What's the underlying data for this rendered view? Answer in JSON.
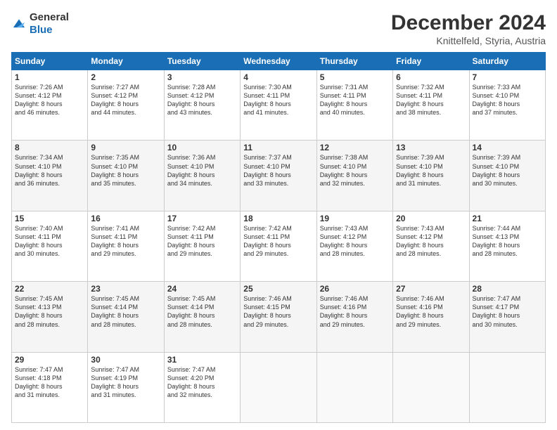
{
  "header": {
    "logo_general": "General",
    "logo_blue": "Blue",
    "month": "December 2024",
    "location": "Knittelfeld, Styria, Austria"
  },
  "weekdays": [
    "Sunday",
    "Monday",
    "Tuesday",
    "Wednesday",
    "Thursday",
    "Friday",
    "Saturday"
  ],
  "weeks": [
    [
      {
        "day": "1",
        "info": "Sunrise: 7:26 AM\nSunset: 4:12 PM\nDaylight: 8 hours\nand 46 minutes."
      },
      {
        "day": "2",
        "info": "Sunrise: 7:27 AM\nSunset: 4:12 PM\nDaylight: 8 hours\nand 44 minutes."
      },
      {
        "day": "3",
        "info": "Sunrise: 7:28 AM\nSunset: 4:12 PM\nDaylight: 8 hours\nand 43 minutes."
      },
      {
        "day": "4",
        "info": "Sunrise: 7:30 AM\nSunset: 4:11 PM\nDaylight: 8 hours\nand 41 minutes."
      },
      {
        "day": "5",
        "info": "Sunrise: 7:31 AM\nSunset: 4:11 PM\nDaylight: 8 hours\nand 40 minutes."
      },
      {
        "day": "6",
        "info": "Sunrise: 7:32 AM\nSunset: 4:11 PM\nDaylight: 8 hours\nand 38 minutes."
      },
      {
        "day": "7",
        "info": "Sunrise: 7:33 AM\nSunset: 4:10 PM\nDaylight: 8 hours\nand 37 minutes."
      }
    ],
    [
      {
        "day": "8",
        "info": "Sunrise: 7:34 AM\nSunset: 4:10 PM\nDaylight: 8 hours\nand 36 minutes."
      },
      {
        "day": "9",
        "info": "Sunrise: 7:35 AM\nSunset: 4:10 PM\nDaylight: 8 hours\nand 35 minutes."
      },
      {
        "day": "10",
        "info": "Sunrise: 7:36 AM\nSunset: 4:10 PM\nDaylight: 8 hours\nand 34 minutes."
      },
      {
        "day": "11",
        "info": "Sunrise: 7:37 AM\nSunset: 4:10 PM\nDaylight: 8 hours\nand 33 minutes."
      },
      {
        "day": "12",
        "info": "Sunrise: 7:38 AM\nSunset: 4:10 PM\nDaylight: 8 hours\nand 32 minutes."
      },
      {
        "day": "13",
        "info": "Sunrise: 7:39 AM\nSunset: 4:10 PM\nDaylight: 8 hours\nand 31 minutes."
      },
      {
        "day": "14",
        "info": "Sunrise: 7:39 AM\nSunset: 4:10 PM\nDaylight: 8 hours\nand 30 minutes."
      }
    ],
    [
      {
        "day": "15",
        "info": "Sunrise: 7:40 AM\nSunset: 4:11 PM\nDaylight: 8 hours\nand 30 minutes."
      },
      {
        "day": "16",
        "info": "Sunrise: 7:41 AM\nSunset: 4:11 PM\nDaylight: 8 hours\nand 29 minutes."
      },
      {
        "day": "17",
        "info": "Sunrise: 7:42 AM\nSunset: 4:11 PM\nDaylight: 8 hours\nand 29 minutes."
      },
      {
        "day": "18",
        "info": "Sunrise: 7:42 AM\nSunset: 4:11 PM\nDaylight: 8 hours\nand 29 minutes."
      },
      {
        "day": "19",
        "info": "Sunrise: 7:43 AM\nSunset: 4:12 PM\nDaylight: 8 hours\nand 28 minutes."
      },
      {
        "day": "20",
        "info": "Sunrise: 7:43 AM\nSunset: 4:12 PM\nDaylight: 8 hours\nand 28 minutes."
      },
      {
        "day": "21",
        "info": "Sunrise: 7:44 AM\nSunset: 4:13 PM\nDaylight: 8 hours\nand 28 minutes."
      }
    ],
    [
      {
        "day": "22",
        "info": "Sunrise: 7:45 AM\nSunset: 4:13 PM\nDaylight: 8 hours\nand 28 minutes."
      },
      {
        "day": "23",
        "info": "Sunrise: 7:45 AM\nSunset: 4:14 PM\nDaylight: 8 hours\nand 28 minutes."
      },
      {
        "day": "24",
        "info": "Sunrise: 7:45 AM\nSunset: 4:14 PM\nDaylight: 8 hours\nand 28 minutes."
      },
      {
        "day": "25",
        "info": "Sunrise: 7:46 AM\nSunset: 4:15 PM\nDaylight: 8 hours\nand 29 minutes."
      },
      {
        "day": "26",
        "info": "Sunrise: 7:46 AM\nSunset: 4:16 PM\nDaylight: 8 hours\nand 29 minutes."
      },
      {
        "day": "27",
        "info": "Sunrise: 7:46 AM\nSunset: 4:16 PM\nDaylight: 8 hours\nand 29 minutes."
      },
      {
        "day": "28",
        "info": "Sunrise: 7:47 AM\nSunset: 4:17 PM\nDaylight: 8 hours\nand 30 minutes."
      }
    ],
    [
      {
        "day": "29",
        "info": "Sunrise: 7:47 AM\nSunset: 4:18 PM\nDaylight: 8 hours\nand 31 minutes."
      },
      {
        "day": "30",
        "info": "Sunrise: 7:47 AM\nSunset: 4:19 PM\nDaylight: 8 hours\nand 31 minutes."
      },
      {
        "day": "31",
        "info": "Sunrise: 7:47 AM\nSunset: 4:20 PM\nDaylight: 8 hours\nand 32 minutes."
      },
      {
        "day": "",
        "info": ""
      },
      {
        "day": "",
        "info": ""
      },
      {
        "day": "",
        "info": ""
      },
      {
        "day": "",
        "info": ""
      }
    ]
  ]
}
